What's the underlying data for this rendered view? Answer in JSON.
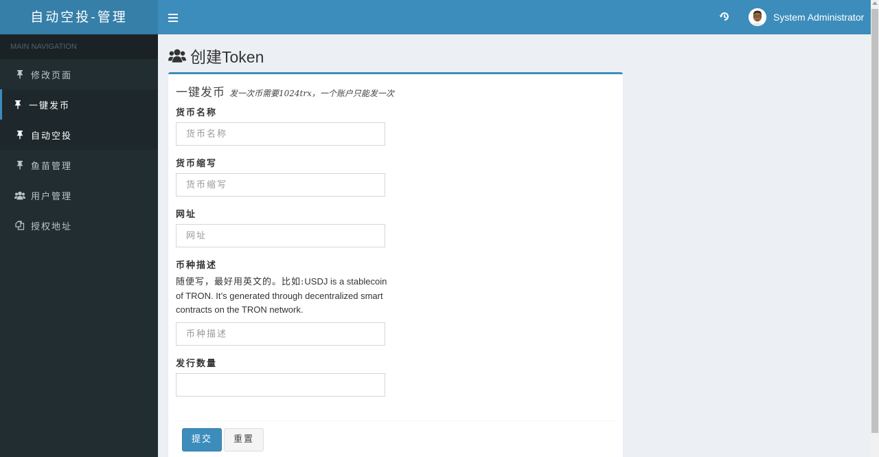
{
  "app": {
    "logo": "自动空投-管理",
    "user_name": "System Administrator"
  },
  "sidebar": {
    "header": "MAIN NAVIGATION",
    "items": [
      {
        "label": "修改页面",
        "icon": "pushpin-icon",
        "state": "normal"
      },
      {
        "label": "一键发币",
        "icon": "pushpin-icon",
        "state": "active"
      },
      {
        "label": "自动空投",
        "icon": "pushpin-icon",
        "state": "hover"
      },
      {
        "label": "鱼苗管理",
        "icon": "pushpin-icon",
        "state": "normal"
      },
      {
        "label": "用户管理",
        "icon": "users-icon",
        "state": "normal"
      },
      {
        "label": "授权地址",
        "icon": "copy-icon",
        "state": "normal"
      }
    ]
  },
  "page": {
    "title_zh": "创建",
    "title_en": "Token"
  },
  "box": {
    "title": "一键发币",
    "subtitle": "发一次币需要1024trx，一个账户只能发一次"
  },
  "form": {
    "fields": [
      {
        "label": "货币名称",
        "placeholder": "货币名称",
        "value": ""
      },
      {
        "label": "货币缩写",
        "placeholder": "货币缩写",
        "value": ""
      },
      {
        "label": "网址",
        "placeholder": "网址",
        "value": ""
      },
      {
        "label": "币种描述",
        "placeholder": "币种描述",
        "value": "",
        "help_zh": "随便写，最好用英文的。比如:",
        "help_en": "USDJ is a stablecoin of TRON. It’s generated through decentralized smart contracts on the TRON network."
      },
      {
        "label": "发行数量",
        "placeholder": "",
        "value": ""
      }
    ],
    "submit_label": "提交",
    "reset_label": "重置"
  },
  "colors": {
    "brand": "#3c8dbc",
    "brand_dark": "#367fa9",
    "sidebar_bg": "#222d32",
    "content_bg": "#ecf0f5"
  }
}
